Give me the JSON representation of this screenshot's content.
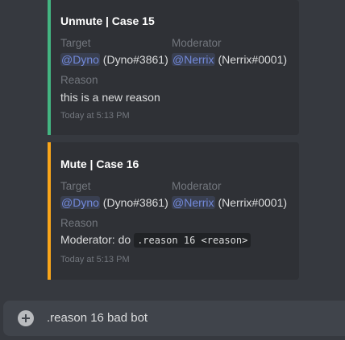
{
  "embeds": [
    {
      "title": "Unmute | Case 15",
      "target_label": "Target",
      "target_mention": "@Dyno",
      "target_tag": "(Dyno#3861)",
      "moderator_label": "Moderator",
      "moderator_mention": "@Nerrix",
      "moderator_tag": "(Nerrix#0001)",
      "reason_label": "Reason",
      "reason_text": "this is a new reason",
      "timestamp": "Today at 5:13 PM",
      "accent": "#43b581"
    },
    {
      "title": "Mute | Case 16",
      "target_label": "Target",
      "target_mention": "@Dyno",
      "target_tag": "(Dyno#3861)",
      "moderator_label": "Moderator",
      "moderator_mention": "@Nerrix",
      "moderator_tag": "(Nerrix#0001)",
      "reason_label": "Reason",
      "reason_prefix": "Moderator: do",
      "reason_code": ".reason 16 <reason>",
      "timestamp": "Today at 5:13 PM",
      "accent": "#faa61a"
    }
  ],
  "composer": {
    "icon": "add-circle-icon",
    "value": ".reason 16 bad bot"
  }
}
